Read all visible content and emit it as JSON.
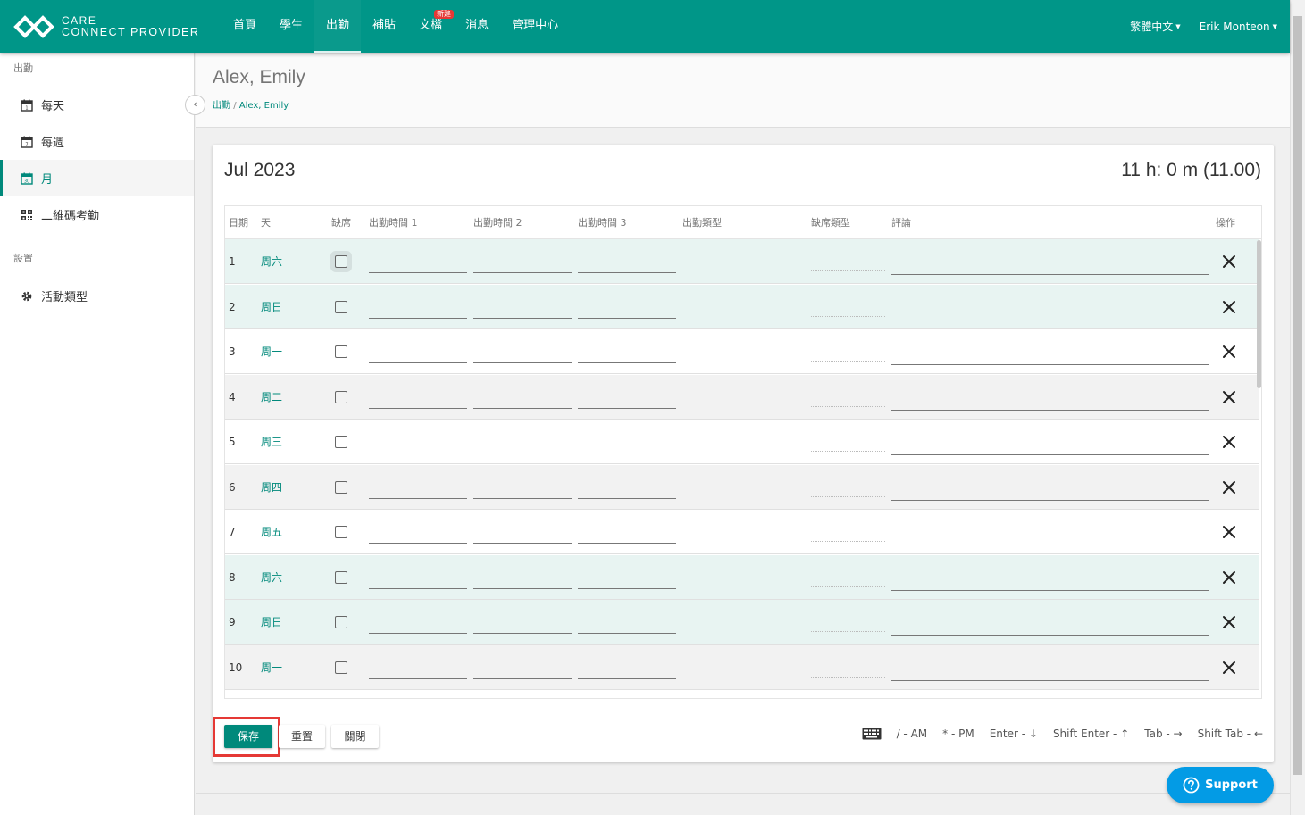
{
  "brand": {
    "line1": "CARE",
    "line2": "CONNECT PROVIDER"
  },
  "nav": [
    {
      "label": "首頁",
      "active": false,
      "badge": ""
    },
    {
      "label": "學生",
      "active": false,
      "badge": ""
    },
    {
      "label": "出勤",
      "active": true,
      "badge": ""
    },
    {
      "label": "補貼",
      "active": false,
      "badge": ""
    },
    {
      "label": "文檔",
      "active": false,
      "badge": "新建"
    },
    {
      "label": "消息",
      "active": false,
      "badge": ""
    },
    {
      "label": "管理中心",
      "active": false,
      "badge": ""
    }
  ],
  "top_right": {
    "language": "繁體中文",
    "user": "Erik Monteon"
  },
  "sidebar": {
    "section_attendance": "出勤",
    "items": [
      {
        "label": "每天",
        "icon": "calendar-day-icon",
        "active": false
      },
      {
        "label": "每週",
        "icon": "calendar-week-icon",
        "active": false
      },
      {
        "label": "月",
        "icon": "calendar-month-icon",
        "active": true
      },
      {
        "label": "二維碼考勤",
        "icon": "qr-code-icon",
        "active": false
      }
    ],
    "section_settings": "設置",
    "settings_items": [
      {
        "label": "活動類型",
        "icon": "gear-icon"
      }
    ]
  },
  "page": {
    "title": "Alex, Emily",
    "breadcrumb_root": "出勤",
    "breadcrumb_sep": "/",
    "breadcrumb_current": "Alex, Emily"
  },
  "card": {
    "month": "Jul 2023",
    "total_hours": "11 h: 0 m (11.00)"
  },
  "table": {
    "headers": [
      "日期",
      "天",
      "缺席",
      "出勤時間 1",
      "出勤時間 2",
      "出勤時間 3",
      "出勤類型",
      "缺席類型",
      "評論",
      "操作"
    ],
    "rows": [
      {
        "date": "1",
        "day": "周六",
        "weekend": true
      },
      {
        "date": "2",
        "day": "周日",
        "weekend": true
      },
      {
        "date": "3",
        "day": "周一",
        "weekend": false
      },
      {
        "date": "4",
        "day": "周二",
        "weekend": false
      },
      {
        "date": "5",
        "day": "周三",
        "weekend": false
      },
      {
        "date": "6",
        "day": "周四",
        "weekend": false
      },
      {
        "date": "7",
        "day": "周五",
        "weekend": false
      },
      {
        "date": "8",
        "day": "周六",
        "weekend": true
      },
      {
        "date": "9",
        "day": "周日",
        "weekend": true
      },
      {
        "date": "10",
        "day": "周一",
        "weekend": false
      }
    ]
  },
  "buttons": {
    "save": "保存",
    "reset": "重置",
    "close": "關閉"
  },
  "shortcuts": [
    {
      "label": "/ - AM"
    },
    {
      "label": "* - PM"
    },
    {
      "label": "Enter - ↓"
    },
    {
      "label": "Shift Enter - ↑"
    },
    {
      "label": "Tab - →"
    },
    {
      "label": "Shift Tab - ←"
    }
  ],
  "support": {
    "label": "Support"
  },
  "colors": {
    "primary": "#009688",
    "accent": "#00897b",
    "weekend_row": "#e8f4f2",
    "support": "#039be5",
    "highlight": "#e53935"
  }
}
